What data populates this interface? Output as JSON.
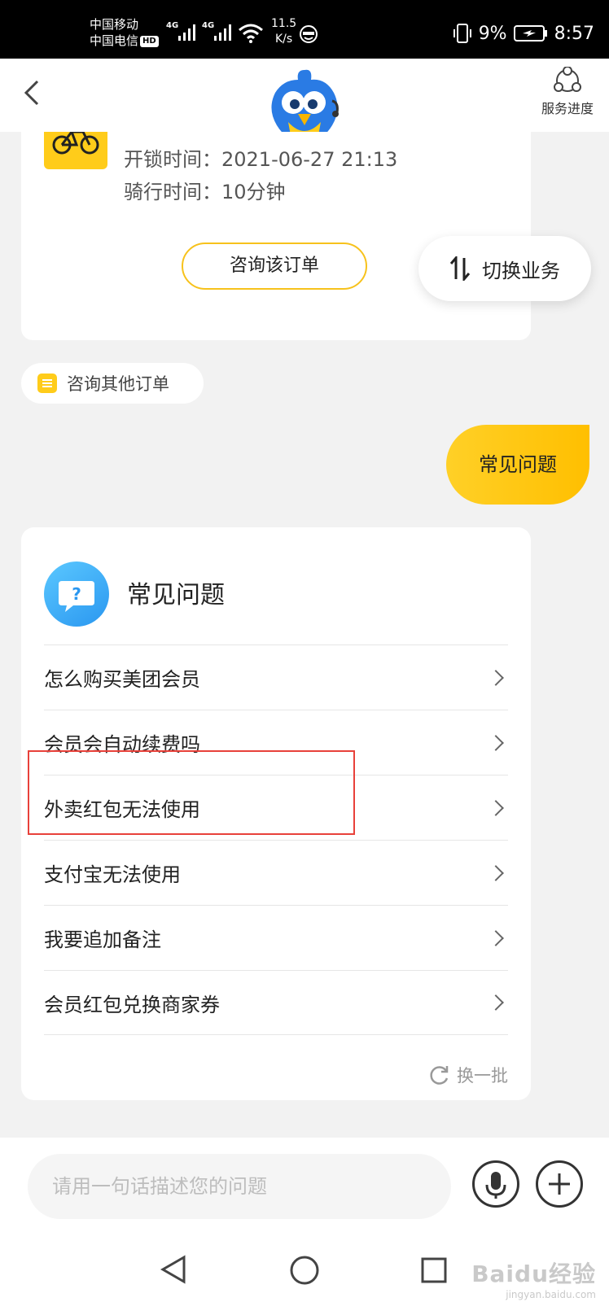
{
  "status_bar": {
    "carrier_1": "中国移动",
    "carrier_2": "中国电信",
    "hd_badge": "HD",
    "network_1": "4G",
    "network_2": "4G",
    "net_speed_value": "11.5",
    "net_speed_unit": "K/s",
    "battery": "9%",
    "time": "8:57"
  },
  "header": {
    "service_progress_label": "服务进度"
  },
  "order_card": {
    "unlock_time": "开锁时间：2021-06-27 21:13",
    "ride_time": "骑行时间：10分钟",
    "consult_button": "咨询该订单"
  },
  "switch_business_label": "切换业务",
  "other_orders_label": "咨询其他订单",
  "user_message": "常见问题",
  "faq": {
    "title": "常见问题",
    "items": [
      "怎么购买美团会员",
      "会员会自动续费吗",
      "外卖红包无法使用",
      "支付宝无法使用",
      "我要追加备注",
      "会员红包兑换商家券"
    ],
    "refresh_label": "换一批"
  },
  "input_bar": {
    "placeholder": "请用一句话描述您的问题"
  },
  "watermark": {
    "brand": "Baidu经验",
    "domain": "jingyan.baidu.com"
  },
  "colors": {
    "accent_yellow": "#ffcc1a",
    "highlight_red": "#e8413a"
  }
}
